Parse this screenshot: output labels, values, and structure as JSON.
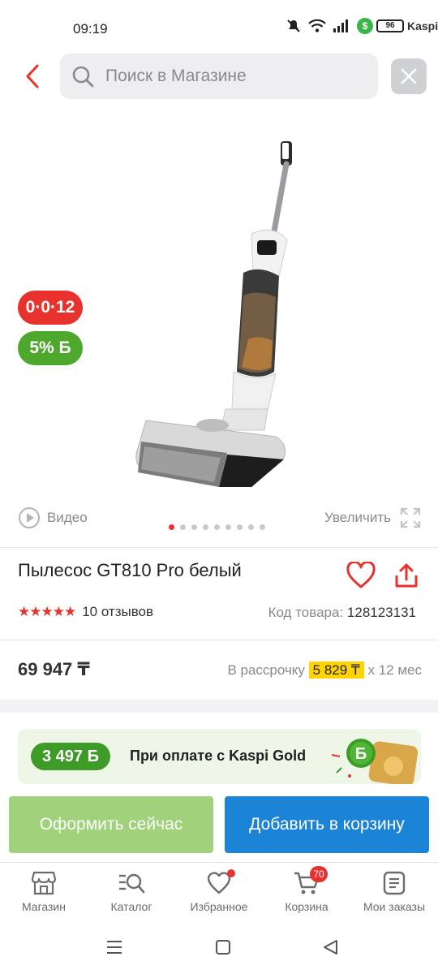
{
  "status": {
    "time": "09:19",
    "battery": "96",
    "app_mark": "Kaspi.kz",
    "app_mark_letter": "$"
  },
  "search": {
    "placeholder": "Поиск в Магазине",
    "icon": "search-icon",
    "back_icon": "back-arrow-icon",
    "close_icon": "close-icon"
  },
  "gallery": {
    "installment_badge": "0·0·12",
    "bonus_badge": "5% Б",
    "video_label": "Видео",
    "zoom_label": "Увеличить",
    "slide_count": 9,
    "active_slide": 0
  },
  "product": {
    "title": "Пылесос GT810 Pro белый",
    "rating": 5,
    "stars": "★★★★★",
    "reviews": "10 отзывов",
    "sku_label": "Код товара:",
    "sku": "128123131",
    "price": "69 947 ₸",
    "installment_prefix": "В рассрочку",
    "installment_amount": "5 829 ₸",
    "installment_suffix": "x 12 мес"
  },
  "promo": {
    "bonus_amount": "3 497 Б",
    "text": "При оплате с Kaspi Gold",
    "decor_letter": "Б"
  },
  "actions": {
    "buy_now": "Оформить сейчас",
    "add_to_cart": "Добавить в корзину"
  },
  "tabs": [
    {
      "label": "Магазин",
      "icon": "shop-icon"
    },
    {
      "label": "Каталог",
      "icon": "catalog-search-icon"
    },
    {
      "label": "Избранное",
      "icon": "heart-icon",
      "dot": true
    },
    {
      "label": "Корзина",
      "icon": "cart-icon",
      "badge": "70"
    },
    {
      "label": "Мои заказы",
      "icon": "orders-icon"
    }
  ],
  "colors": {
    "accent_red": "#e8322e",
    "bonus_green": "#4fa82e",
    "primary_blue": "#1c84d6",
    "buy_green": "#9fd27a",
    "highlight_yellow": "#ffd400"
  }
}
